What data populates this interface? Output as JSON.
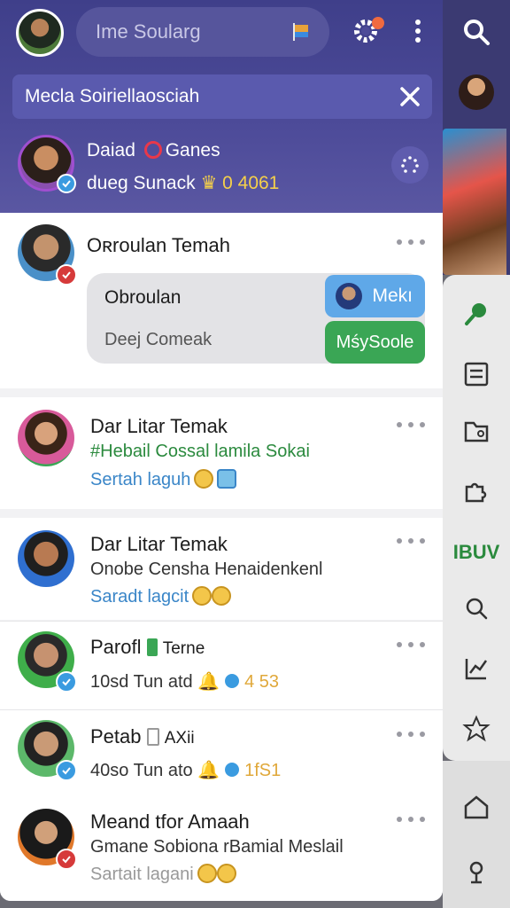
{
  "header": {
    "search_placeholder": "Ime Soularg",
    "notice_text": "Mecla Soiriellaosciah"
  },
  "pinned": {
    "name_a": "Daiad",
    "name_b": "Ganes",
    "sub_text": "dueg Sunack",
    "sub_amount": "0 4061"
  },
  "chats": [
    {
      "title": "Oʀroulan Temah",
      "bubble_name": "Obroulan",
      "bubble_sub": "Deej Comeak",
      "chip_blue": "Mekı",
      "chip_green": "MśySoole"
    },
    {
      "title": "Dar Litar Temak",
      "line1": "#Hebail Cossal lamila Sokai",
      "line2": "Sertah laguh"
    },
    {
      "title": "Dar Litar Temak",
      "line1": "Onobe Censha Henaidenkenl",
      "line2": "Saradt lagcit"
    },
    {
      "title_a": "Parofl",
      "title_b": "Terne",
      "line1": "10sd Tun atd",
      "count": "4 53"
    },
    {
      "title_a": "Petab",
      "title_b": "AXii",
      "line1": "40so Tun ato",
      "count": "1fS1"
    },
    {
      "title": "Meand tfor Amaah",
      "line1": "Gmane Sobiona rBamial Meslail",
      "line2": "Sartait lagani"
    }
  ],
  "sidebar": {
    "text_label": "IBUV"
  },
  "colors": {
    "header": "#4d4b99",
    "accent_green": "#2b8a3e",
    "accent_blue": "#3a9be0",
    "amount_yellow": "#f5d04a"
  }
}
